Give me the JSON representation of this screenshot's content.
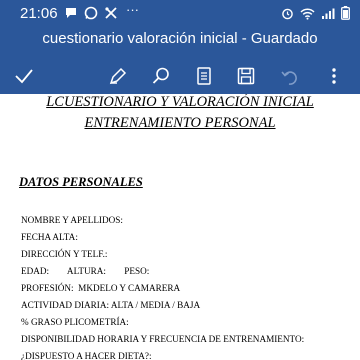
{
  "status_bar": {
    "time": "21:06",
    "more": "···"
  },
  "document": {
    "title": "cuestionario valoración inicial - Guardado"
  },
  "colors": {
    "header_bg": "#2b579a",
    "header_text": "#ffffff",
    "page_bg": "#ffffff"
  },
  "toolbar": {
    "icons": [
      "check-icon",
      "pen-icon",
      "search-icon",
      "read-mode-icon",
      "save-icon",
      "undo-icon",
      "more-options-icon"
    ]
  },
  "content": {
    "heading_line1": "LCUESTIONARIO Y VALORACIÓN INICIAL",
    "heading_line2": "ENTRENAMIENTO PERSONAL",
    "section_title": "DATOS PERSONALES",
    "fields": [
      "NOMBRE Y APELLIDOS:",
      "FECHA ALTA:",
      "DIRECCIÓN Y TELF.:",
      "EDAD:        ALTURA:        PESO:",
      "PROFESIÓN:  MKDELO Y CAMARERA",
      "ACTIVIDAD DIARIA: ALTA / MEDIA / BAJA",
      "% GRASO PLICOMETRÍA:",
      "DISPONIBILIDAD HORARIA Y FRECUENCIA DE ENTRENAMIENTO:",
      "¿DISPUESTO A HACER DIETA?:"
    ]
  }
}
